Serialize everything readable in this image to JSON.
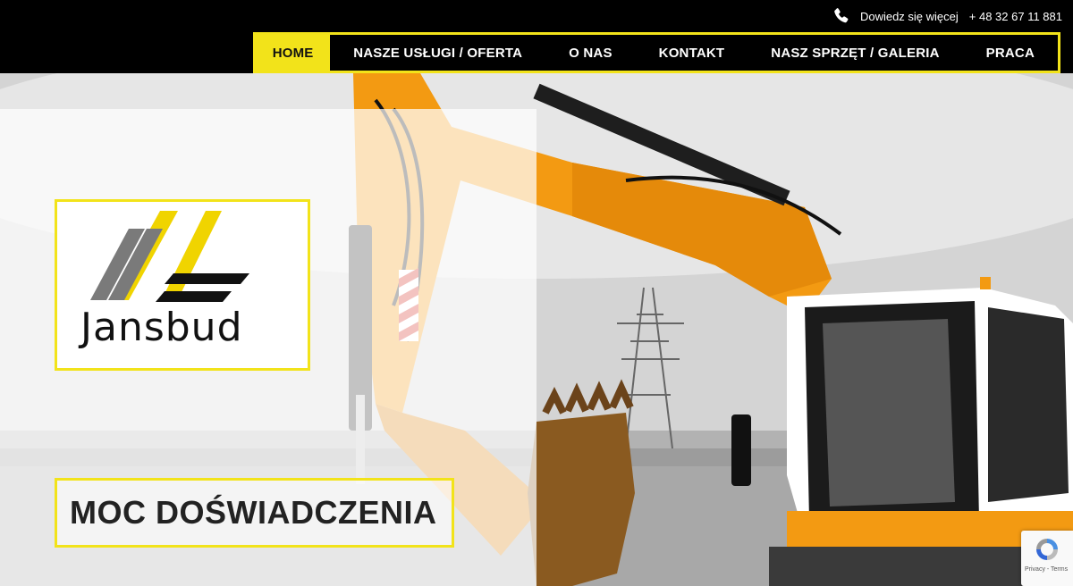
{
  "header": {
    "phone_icon": "phone-icon",
    "contact_label": "Dowiedz się więcej",
    "phone_number": "+ 48 32 67 11 881"
  },
  "nav": {
    "items": [
      {
        "label": "HOME",
        "active": true
      },
      {
        "label": "NASZE USŁUGI / OFERTA",
        "active": false
      },
      {
        "label": "O NAS",
        "active": false
      },
      {
        "label": "KONTAKT",
        "active": false
      },
      {
        "label": "NASZ SPRZĘT / GALERIA",
        "active": false
      },
      {
        "label": "PRACA",
        "active": false
      }
    ]
  },
  "hero": {
    "logo_text": "Jansbud",
    "tagline": "MOC DOŚWIADCZENIA"
  },
  "recaptcha": {
    "icon": "recaptcha-icon",
    "text": "Privacy - Terms"
  },
  "colors": {
    "accent": "#f2e31a",
    "excavator": "#f39a12",
    "dark": "#000000"
  }
}
